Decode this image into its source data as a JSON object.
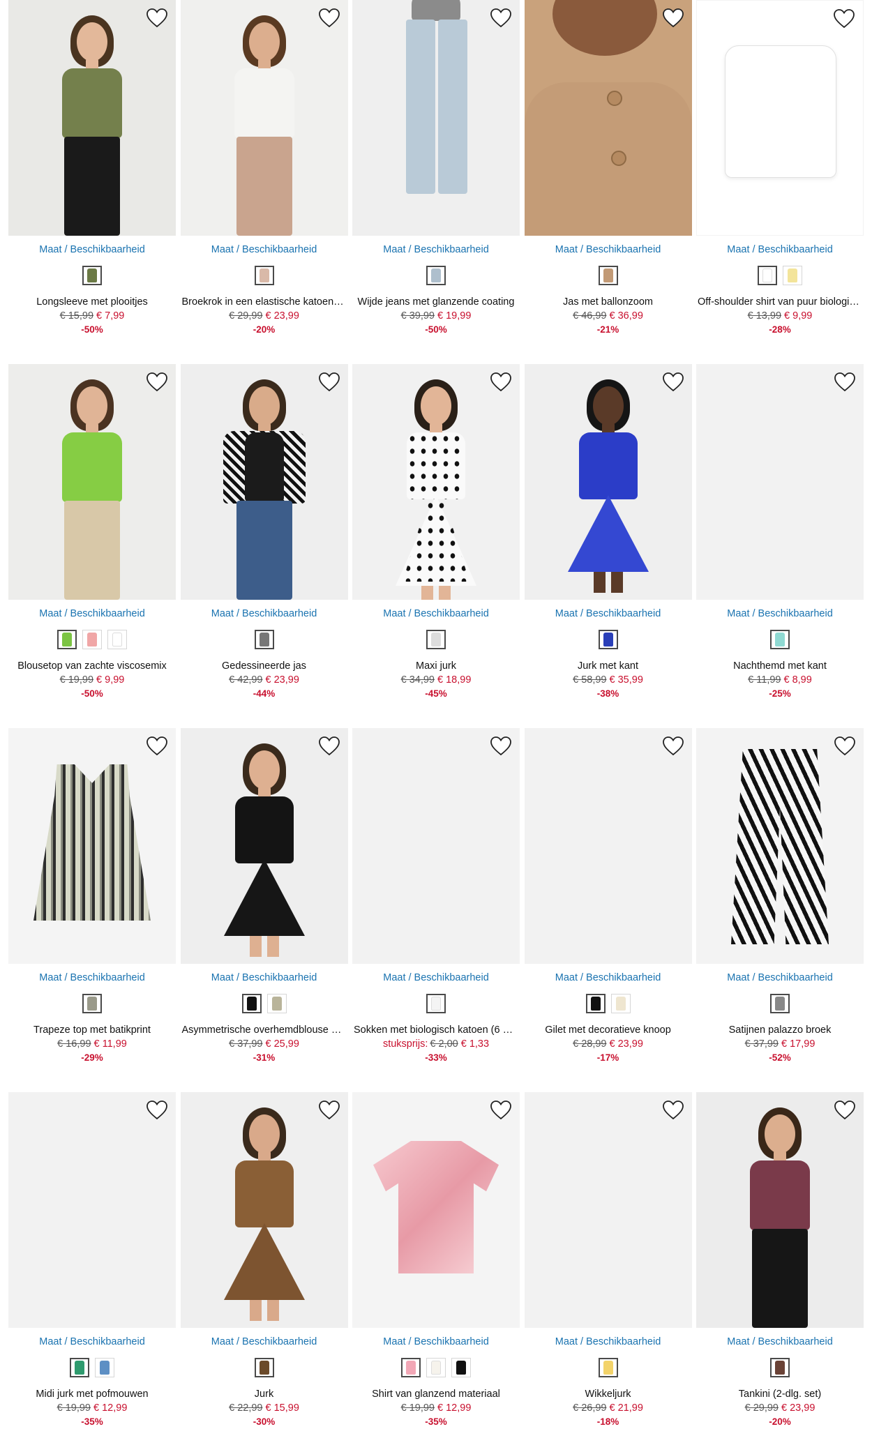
{
  "products": [
    {
      "size_label": "Maat / Beschikbaarheid",
      "name": "Longsleeve met plooitjes",
      "old_price": "€ 15,99",
      "new_price": "€ 7,99",
      "discount": "-50%",
      "bg": "#e9e9e6",
      "swatches": [
        "#6b7a45"
      ],
      "visual": "model",
      "hair": "#4a3420",
      "top": "#74804c",
      "bottom": "#1a1a1a",
      "skin": "#e3b89a"
    },
    {
      "size_label": "Maat / Beschikbaarheid",
      "name": "Broekrok in een elastische katoenmix",
      "old_price": "€ 29,99",
      "new_price": "€ 23,99",
      "discount": "-20%",
      "bg": "#f0f0ee",
      "swatches": [
        "#d9b9a8"
      ],
      "visual": "model",
      "hair": "#5a3a22",
      "top": "#f4f4f2",
      "bottom": "#c9a48e",
      "skin": "#dcae8e"
    },
    {
      "size_label": "Maat / Beschikbaarheid",
      "name": "Wijde jeans met glanzende coating",
      "old_price": "€ 39,99",
      "new_price": "€ 19,99",
      "discount": "-50%",
      "bg": "#efefef",
      "swatches": [
        "#aebfcd"
      ],
      "visual": "jeans",
      "top": "#8b8b8b",
      "bottom": "#b9cad7",
      "skin": "#e2b89b"
    },
    {
      "size_label": "Maat / Beschikbaarheid",
      "name": "Jas met ballonzoom",
      "old_price": "€ 46,99",
      "new_price": "€ 36,99",
      "discount": "-21%",
      "bg": "#c9a27c",
      "swatches": [
        "#c29a76"
      ],
      "visual": "closeup",
      "top": "#c49c77",
      "skin": "#8a5a3c"
    },
    {
      "size_label": "Maat / Beschikbaarheid",
      "name": "Off-shoulder shirt van puur biologis...",
      "old_price": "€ 13,99",
      "new_price": "€ 9,99",
      "discount": "-28%",
      "bg": "#ffffff",
      "swatches": [
        "#ffffff",
        "#f3e49a"
      ],
      "visual": "flat-top",
      "top": "#ffffff"
    },
    {
      "size_label": "Maat / Beschikbaarheid",
      "name": "Blousetop van zachte viscosemix",
      "old_price": "€ 19,99",
      "new_price": "€ 9,99",
      "discount": "-50%",
      "bg": "#ededeb",
      "swatches": [
        "#7cc444",
        "#f0a6a6",
        "#ffffff"
      ],
      "visual": "model",
      "hair": "#4b3322",
      "top": "#86cd44",
      "bottom": "#d8c8a8",
      "skin": "#e0b496"
    },
    {
      "size_label": "Maat / Beschikbaarheid",
      "name": "Gedessineerde jas",
      "old_price": "€ 42,99",
      "new_price": "€ 23,99",
      "discount": "-44%",
      "bg": "#eeeeee",
      "swatches": [
        "#777777"
      ],
      "visual": "model",
      "hair": "#3a2a1c",
      "top": "#1b1b1b",
      "bottom": "#3d5d8a",
      "skin": "#d9ab8a",
      "jacket": "#9a9a9a"
    },
    {
      "size_label": "Maat / Beschikbaarheid",
      "name": "Maxi jurk",
      "old_price": "€ 34,99",
      "new_price": "€ 18,99",
      "discount": "-45%",
      "bg": "#f1f1f1",
      "swatches": [
        "#dddddd"
      ],
      "visual": "dress-dots",
      "hair": "#2a2018",
      "top": "#fafafa",
      "bottom": "#fafafa",
      "skin": "#e2b597"
    },
    {
      "size_label": "Maat / Beschikbaarheid",
      "name": "Jurk met kant",
      "old_price": "€ 58,99",
      "new_price": "€ 35,99",
      "discount": "-38%",
      "bg": "#efefef",
      "swatches": [
        "#2a3fb8"
      ],
      "visual": "dress",
      "hair": "#151515",
      "top": "#2b3dc8",
      "bottom": "#3448d2",
      "skin": "#5a3a28"
    },
    {
      "size_label": "Maat / Beschikbaarheid",
      "name": "Nachthemd met kant",
      "old_price": "€ 11,99",
      "new_price": "€ 8,99",
      "discount": "-25%",
      "bg": "#f2f2f2",
      "swatches": [
        "#8fd9d2"
      ],
      "visual": "empty"
    },
    {
      "size_label": "Maat / Beschikbaarheid",
      "name": "Trapeze top met batikprint",
      "old_price": "€ 16,99",
      "new_price": "€ 11,99",
      "discount": "-29%",
      "bg": "#f4f4f4",
      "swatches": [
        "#9a9a8a"
      ],
      "visual": "flat-tank",
      "top": "#c9ccbc"
    },
    {
      "size_label": "Maat / Beschikbaarheid",
      "name": "Asymmetrische overhemdblouse va...",
      "old_price": "€ 37,99",
      "new_price": "€ 25,99",
      "discount": "-31%",
      "bg": "#eeeeee",
      "swatches": [
        "#111111",
        "#b9b49a"
      ],
      "visual": "dress",
      "hair": "#3a2a1c",
      "top": "#141414",
      "bottom": "#161616",
      "skin": "#deb091"
    },
    {
      "size_label": "Maat / Beschikbaarheid",
      "name": "Sokken met biologisch katoen (6 pa...",
      "old_price": "€ 2,00",
      "new_price": "€ 1,33",
      "discount": "-33%",
      "unit_label": "stuksprijs:",
      "bg": "#f2f2f2",
      "swatches": [
        "#f4f4f4"
      ],
      "visual": "empty"
    },
    {
      "size_label": "Maat / Beschikbaarheid",
      "name": "Gilet met decoratieve knoop",
      "old_price": "€ 28,99",
      "new_price": "€ 23,99",
      "discount": "-17%",
      "bg": "#f2f2f2",
      "swatches": [
        "#111111",
        "#efe6d0"
      ],
      "visual": "empty"
    },
    {
      "size_label": "Maat / Beschikbaarheid",
      "name": "Satijnen palazzo broek",
      "old_price": "€ 37,99",
      "new_price": "€ 17,99",
      "discount": "-52%",
      "bg": "#f3f3f3",
      "swatches": [
        "#888888"
      ],
      "visual": "flat-pants",
      "bottom": "#f4f4f4"
    },
    {
      "size_label": "Maat / Beschikbaarheid",
      "name": "Midi jurk met pofmouwen",
      "old_price": "€ 19,99",
      "new_price": "€ 12,99",
      "discount": "-35%",
      "bg": "#f2f2f2",
      "swatches": [
        "#2e9b6e",
        "#5d8fc4"
      ],
      "visual": "empty"
    },
    {
      "size_label": "Maat / Beschikbaarheid",
      "name": "Jurk",
      "old_price": "€ 22,99",
      "new_price": "€ 15,99",
      "discount": "-30%",
      "bg": "#efefef",
      "swatches": [
        "#6b4a2a"
      ],
      "visual": "dress",
      "hair": "#3a2a1c",
      "top": "#8a5f36",
      "bottom": "#7d5430",
      "skin": "#d9a98a"
    },
    {
      "size_label": "Maat / Beschikbaarheid",
      "name": "Shirt van glanzend materiaal",
      "old_price": "€ 19,99",
      "new_price": "€ 12,99",
      "discount": "-35%",
      "bg": "#f4f4f4",
      "swatches": [
        "#f2a7b6",
        "#f6f3ec",
        "#111111"
      ],
      "visual": "flat-tee",
      "top": "#efb3bb"
    },
    {
      "size_label": "Maat / Beschikbaarheid",
      "name": "Wikkeljurk",
      "old_price": "€ 26,99",
      "new_price": "€ 21,99",
      "discount": "-18%",
      "bg": "#f2f2f2",
      "swatches": [
        "#f3d36a"
      ],
      "visual": "empty"
    },
    {
      "size_label": "Maat / Beschikbaarheid",
      "name": "Tankini (2-dlg. set)",
      "old_price": "€ 29,99",
      "new_price": "€ 23,99",
      "discount": "-20%",
      "bg": "#ececec",
      "swatches": [
        "#6a4236"
      ],
      "visual": "model",
      "hair": "#3a2718",
      "top": "#7a3a4a",
      "bottom": "#161616",
      "skin": "#dcae8e"
    }
  ],
  "icons": {
    "wishlist": "heart-outline-icon"
  }
}
